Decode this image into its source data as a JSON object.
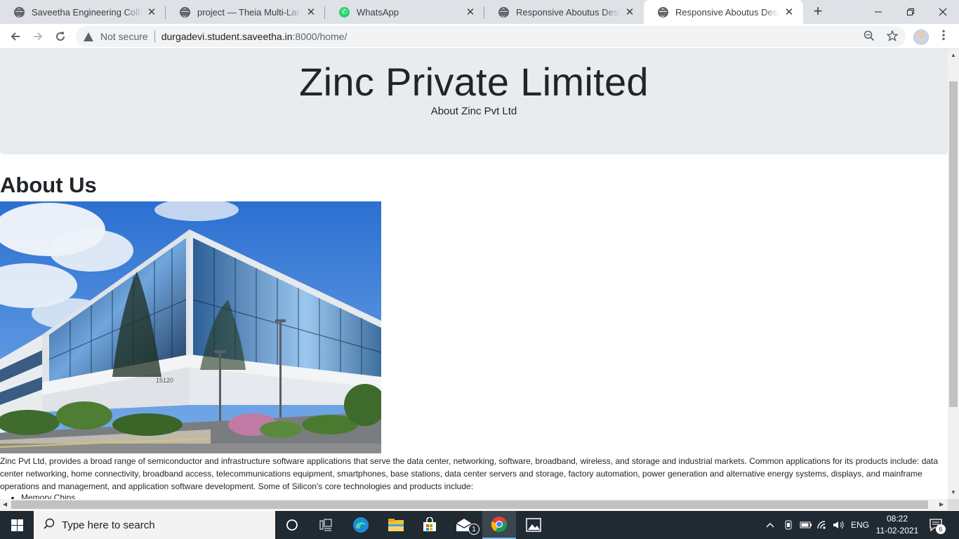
{
  "browser": {
    "tabs": [
      {
        "title": "Saveetha Engineering College",
        "icon": "globe-icon"
      },
      {
        "title": "project — Theia Multi-Language",
        "icon": "globe-icon"
      },
      {
        "title": "WhatsApp",
        "icon": "whatsapp-icon"
      },
      {
        "title": "Responsive Aboutus Design",
        "icon": "globe-icon"
      },
      {
        "title": "Responsive Aboutus Design",
        "icon": "globe-icon",
        "active": true
      }
    ],
    "close_glyph": "✕",
    "new_tab_glyph": "+",
    "security_label": "Not secure",
    "url_host": "durgadevi.student.saveetha.in",
    "url_path": ":8000/home/"
  },
  "page": {
    "title": "Zinc Private Limited",
    "subtitle": "About Zinc Pvt Ltd",
    "section_heading": "About Us",
    "paragraph": "Zinc Pvt Ltd, provides a broad range of semiconductor and infrastructure software applications that serve the data center, networking, software, broadband, wireless, and storage and industrial markets. Common applications for its products include: data center networking, home connectivity, broadband access, telecommunications equipment, smartphones, base stations, data center servers and storage, factory automation, power generation and alternative energy systems, displays, and mainframe operations and management, and application software development. Some of Silicon's core technologies and products include:",
    "products": [
      "Memory Chips"
    ],
    "building_number": "15120"
  },
  "taskbar": {
    "search_placeholder": "Type here to search",
    "language": "ENG",
    "time": "08:22",
    "date": "11-02-2021",
    "mail_badge": "1",
    "notification_count": "6"
  }
}
